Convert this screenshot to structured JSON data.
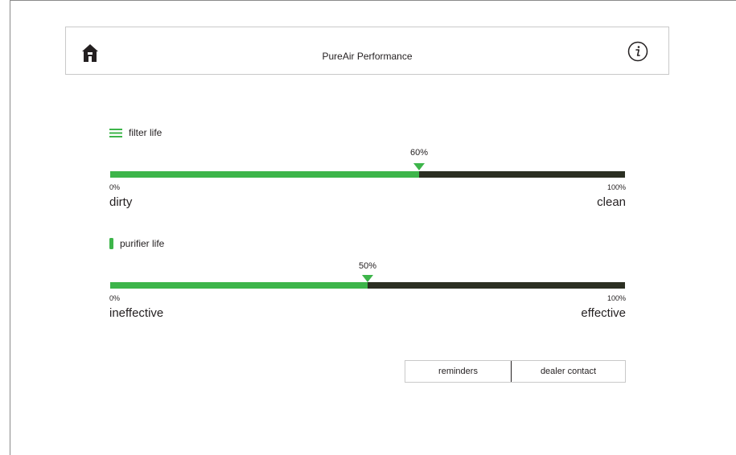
{
  "header": {
    "title": "PureAir Performance"
  },
  "colors": {
    "accent": "#3db54a",
    "track": "#2b2f22",
    "text": "#231f20"
  },
  "icons": {
    "home": "home-icon",
    "info": "info-icon",
    "filter": "lines-icon",
    "purifier": "bar-icon"
  },
  "gauges": [
    {
      "title": "filter life",
      "value": 60,
      "value_label": "60%",
      "min_label": "0%",
      "max_label": "100%",
      "min_text": "dirty",
      "max_text": "clean"
    },
    {
      "title": "purifier life",
      "value": 50,
      "value_label": "50%",
      "min_label": "0%",
      "max_label": "100%",
      "min_text": "ineffective",
      "max_text": "effective"
    }
  ],
  "buttons": {
    "reminders": "reminders",
    "dealer_contact": "dealer contact"
  }
}
